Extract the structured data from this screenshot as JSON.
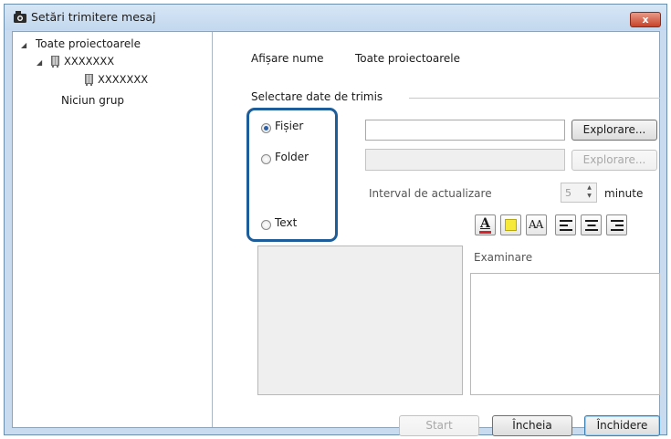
{
  "window": {
    "title": "Setări trimitere mesaj",
    "close_glyph": "x",
    "accent_color": "#1d5d9a"
  },
  "tree": {
    "root": {
      "label": "Toate proiectoarele",
      "icon": "projector-icon"
    },
    "child": {
      "label": "XXXXXXX"
    },
    "grandchild": {
      "label": "XXXXXXX"
    },
    "ungrouped": {
      "label": "Niciun grup"
    }
  },
  "display_name": {
    "label": "Afișare nume",
    "value": "Toate proiectoarele"
  },
  "section_title": "Selectare date de trimis",
  "options": {
    "file": {
      "label": "Fișier",
      "checked": true
    },
    "folder": {
      "label": "Folder",
      "checked": false
    },
    "text": {
      "label": "Text",
      "checked": false
    }
  },
  "browse_file": {
    "label": "Explorare..."
  },
  "browse_folder": {
    "label": "Explorare..."
  },
  "interval": {
    "label": "Interval de actualizare",
    "value": "5",
    "unit": "minute"
  },
  "format_tools": {
    "font_color_glyph": "A",
    "highlight_color": "#f6e93a",
    "font_size_glyph": "AA",
    "font_color": "#d4242c"
  },
  "preview": {
    "label": "Examinare"
  },
  "buttons": {
    "start": "Start",
    "stop": "Încheia",
    "close": "Închidere"
  }
}
